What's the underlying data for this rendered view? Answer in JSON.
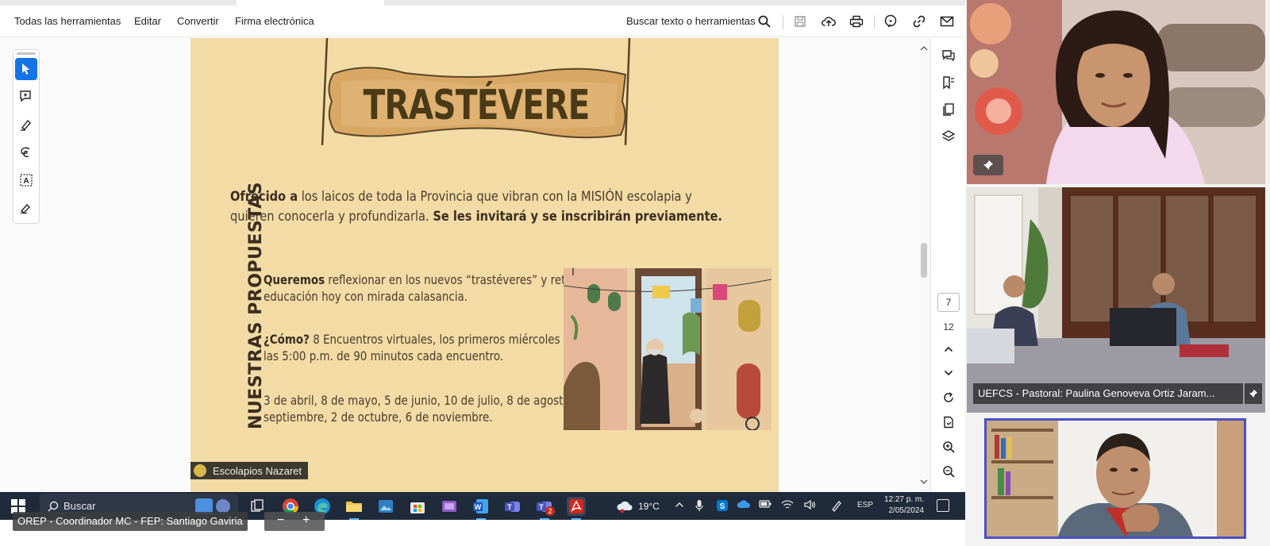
{
  "menubar": {
    "items": [
      "Todas las herramientas",
      "Editar",
      "Convertir",
      "Firma electrónica"
    ],
    "search_label": "Buscar texto o herramientas"
  },
  "icons": {
    "toolbar": [
      "search-icon",
      "save-icon",
      "upload-icon",
      "print-icon",
      "ai-assistant-icon",
      "link-icon",
      "mail-icon"
    ],
    "left_tools": [
      "select-icon",
      "comment-icon",
      "highlight-icon",
      "draw-icon",
      "text-select-icon",
      "sign-icon"
    ],
    "right_rail": [
      "comments-icon",
      "bookmarks-icon",
      "pages-icon",
      "layers-icon"
    ]
  },
  "document": {
    "banner_title": "TRASTÉVERE",
    "intro_bold1": "Ofrecido a",
    "intro_text1": " los laicos de toda la Provincia que vibran con la MISIÓN escolapia y quieren conocerla y profundizarla. ",
    "intro_bold2": "Se les invitará y se inscribirán previamente.",
    "side_title": "NUESTRAS PROPUESTAS",
    "para1_bold": "Queremos",
    "para1_text": " reflexionar en los nuevos “trastéveres” y retos de la educación hoy con mirada calasancia.",
    "para2_bold": "¿Cómo?",
    "para2_text": " 8 Encuentros virtuales, los primeros miércoles de mes a las 5:00 p.m. de 90 minutos cada encuentro.",
    "para3_text": "3 de abril, 8 de mayo, 5 de junio, 10 de julio, 8 de agosto, 4 de septiembre, 2 de octubre, 6 de noviembre.",
    "footer_tag": "Escolapios Nazaret"
  },
  "navigation": {
    "current_page": "7",
    "total_pages": "12"
  },
  "taskbar": {
    "search_placeholder": "Buscar",
    "weather": "19°C",
    "language": "ESP",
    "time": "12:27 p. m.",
    "date": "2/05/2024",
    "teams_badge": "2"
  },
  "zoom": {
    "meeting_label": "OREP - Coordinador MC - FEP: Santiago Gaviria",
    "participant2_name": "UEFCS - Pastoral: Paulina Genoveva Ortiz Jaram..."
  },
  "colors": {
    "accent": "#1473e6",
    "page_background": "#f3dba6",
    "taskbar": "#1f2a3a",
    "speaker_border": "#4b4fc4"
  }
}
